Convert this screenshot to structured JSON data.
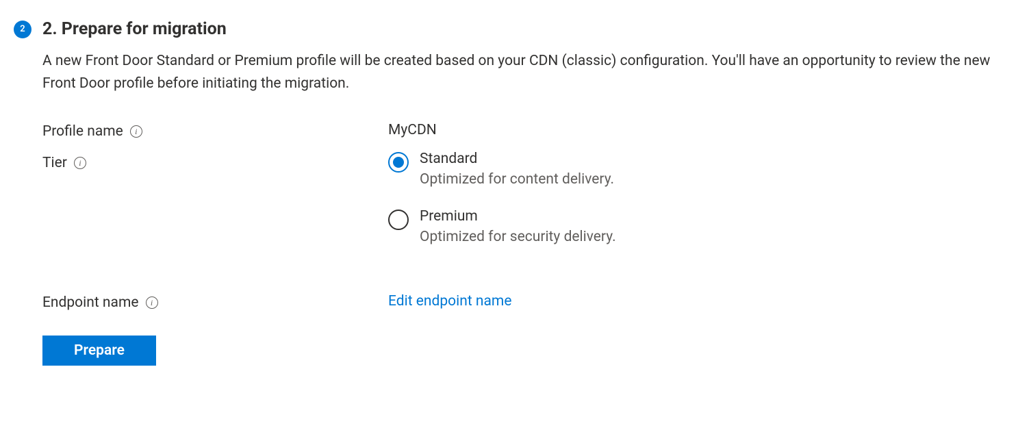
{
  "step": {
    "number": "2",
    "title": "2. Prepare for migration",
    "description": "A new Front Door Standard or Premium profile will be created based on your CDN (classic) configuration. You'll have an opportunity to review the new Front Door profile before initiating the migration."
  },
  "profile": {
    "label": "Profile name",
    "value": "MyCDN"
  },
  "tier": {
    "label": "Tier",
    "options": [
      {
        "label": "Standard",
        "description": "Optimized for content delivery.",
        "selected": true
      },
      {
        "label": "Premium",
        "description": "Optimized for security delivery.",
        "selected": false
      }
    ]
  },
  "endpoint": {
    "label": "Endpoint name",
    "link_text": "Edit endpoint name"
  },
  "button": {
    "prepare": "Prepare"
  }
}
